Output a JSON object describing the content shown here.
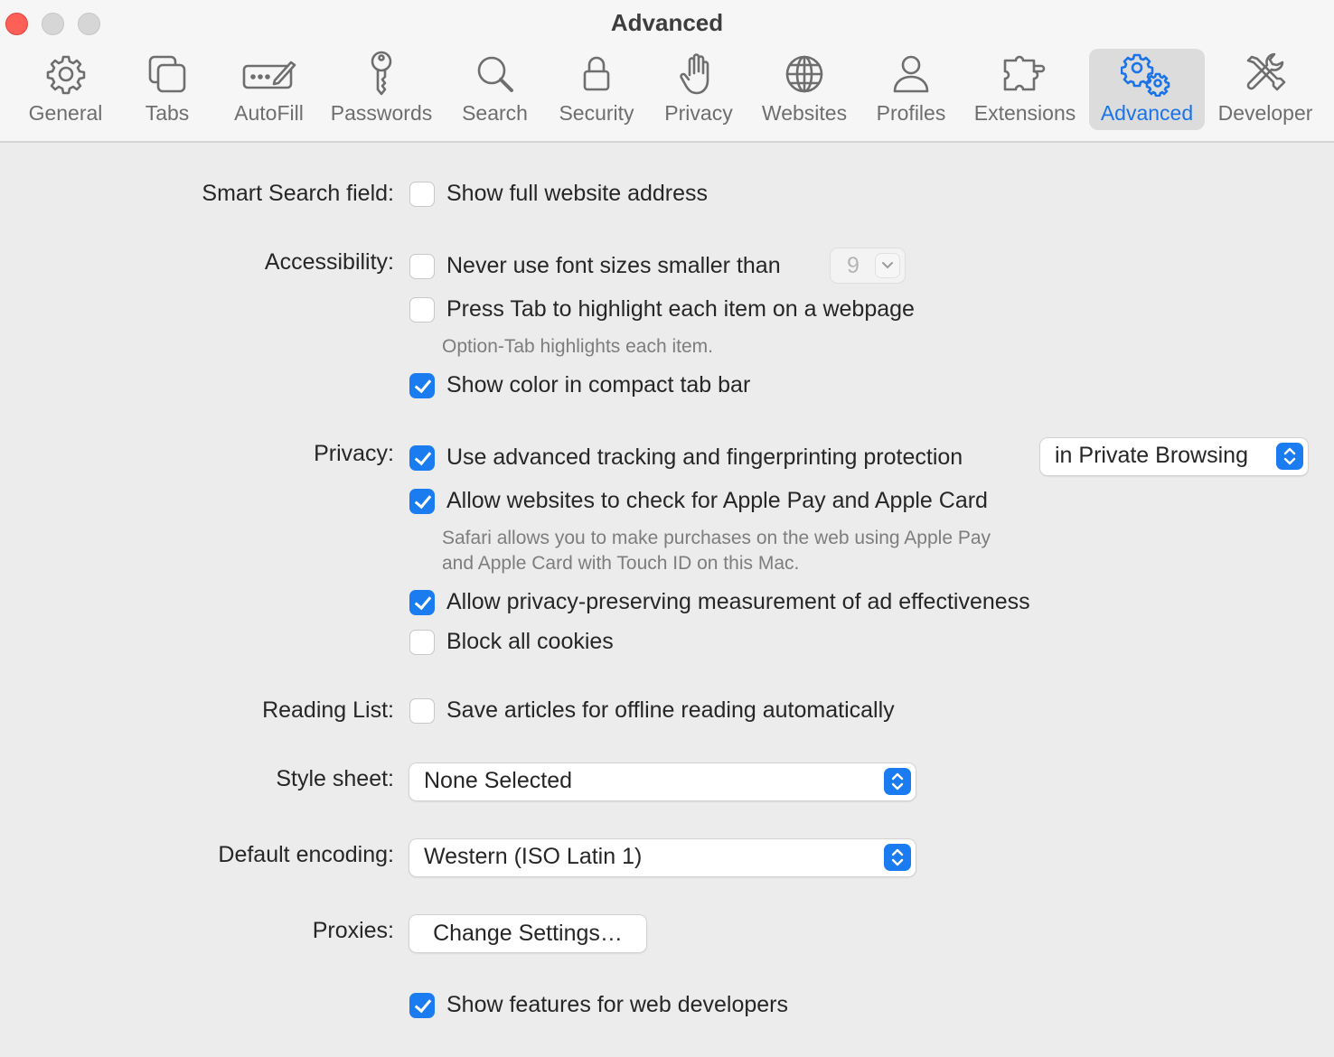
{
  "window": {
    "title": "Advanced",
    "accent_color": "#1a7cf0"
  },
  "toolbar": {
    "items": [
      {
        "label": "General",
        "icon": "gear-icon"
      },
      {
        "label": "Tabs",
        "icon": "tabs-icon"
      },
      {
        "label": "AutoFill",
        "icon": "autofill-icon"
      },
      {
        "label": "Passwords",
        "icon": "key-icon"
      },
      {
        "label": "Search",
        "icon": "search-icon"
      },
      {
        "label": "Security",
        "icon": "lock-icon"
      },
      {
        "label": "Privacy",
        "icon": "hand-icon"
      },
      {
        "label": "Websites",
        "icon": "globe-icon"
      },
      {
        "label": "Profiles",
        "icon": "person-icon"
      },
      {
        "label": "Extensions",
        "icon": "puzzle-icon"
      },
      {
        "label": "Advanced",
        "icon": "gears-icon",
        "selected": true
      },
      {
        "label": "Developer",
        "icon": "tools-icon"
      }
    ]
  },
  "smart_search": {
    "label": "Smart Search field:",
    "show_full_address": {
      "label": "Show full website address",
      "checked": false
    }
  },
  "accessibility": {
    "label": "Accessibility:",
    "min_font": {
      "label": "Never use font sizes smaller than",
      "checked": false,
      "size_value": "9"
    },
    "press_tab": {
      "label": "Press Tab to highlight each item on a webpage",
      "checked": false
    },
    "press_tab_help": "Option-Tab highlights each item.",
    "compact_color": {
      "label": "Show color in compact tab bar",
      "checked": true
    }
  },
  "privacy": {
    "label": "Privacy:",
    "tracking": {
      "label": "Use advanced tracking and fingerprinting protection",
      "checked": true,
      "mode": "in Private Browsing"
    },
    "apple_pay": {
      "label": "Allow websites to check for Apple Pay and Apple Card",
      "checked": true
    },
    "apple_pay_help_1": "Safari allows you to make purchases on the web using Apple Pay",
    "apple_pay_help_2": "and Apple Card with Touch ID on this Mac.",
    "ad_measurement": {
      "label": "Allow privacy-preserving measurement of ad effectiveness",
      "checked": true
    },
    "block_cookies": {
      "label": "Block all cookies",
      "checked": false
    }
  },
  "reading_list": {
    "label": "Reading List:",
    "offline": {
      "label": "Save articles for offline reading automatically",
      "checked": false
    }
  },
  "style_sheet": {
    "label": "Style sheet:",
    "value": "None Selected"
  },
  "encoding": {
    "label": "Default encoding:",
    "value": "Western (ISO Latin 1)"
  },
  "proxies": {
    "label": "Proxies:",
    "button": "Change Settings…"
  },
  "developer": {
    "show_features": {
      "label": "Show features for web developers",
      "checked": true
    }
  }
}
